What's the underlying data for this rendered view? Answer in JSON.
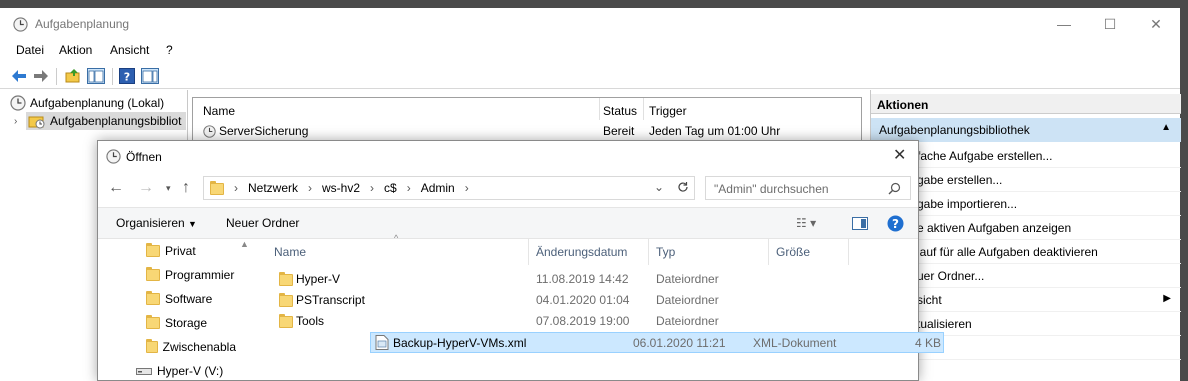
{
  "window": {
    "title": "Aufgabenplanung",
    "min": "—",
    "max": "☐",
    "close": "✕"
  },
  "menu": [
    "Datei",
    "Aktion",
    "Ansicht",
    "?"
  ],
  "tree": {
    "root": "Aufgabenplanung (Lokal)",
    "child": "Aufgabenplanungsbibliot"
  },
  "tasklist": {
    "columns": [
      "Name",
      "Status",
      "Trigger"
    ],
    "rows": [
      {
        "name": "ServerSicherung",
        "status": "Bereit",
        "trigger": "Jeden Tag um 01:00 Uhr"
      }
    ]
  },
  "actions": {
    "header": "Aktionen",
    "section": "Aufgabenplanungsbibliothek",
    "items": [
      "fache Aufgabe erstellen...",
      "gabe erstellen...",
      "gabe importieren...",
      "e aktiven Aufgaben anzeigen",
      "lauf für alle Aufgaben deaktivieren",
      "uer Ordner...",
      "sicht",
      "tualisieren",
      "fe"
    ]
  },
  "dialog": {
    "title": "Öffnen",
    "breadcrumb": [
      "Netzwerk",
      "ws-hv2",
      "c$",
      "Admin"
    ],
    "search_placeholder": "\"Admin\" durchsuchen",
    "organize": "Organisieren",
    "new_folder": "Neuer Ordner",
    "nav_items": [
      "Privat",
      "Programmier",
      "Software",
      "Storage",
      "Zwischenabla",
      "Hyper-V (V:)"
    ],
    "columns": [
      "Name",
      "Änderungsdatum",
      "Typ",
      "Größe"
    ],
    "files": [
      {
        "name": "Hyper-V",
        "date": "11.08.2019 14:42",
        "type": "Dateiordner",
        "size": ""
      },
      {
        "name": "PSTranscript",
        "date": "04.01.2020 01:04",
        "type": "Dateiordner",
        "size": ""
      },
      {
        "name": "Tools",
        "date": "07.08.2019 19:00",
        "type": "Dateiordner",
        "size": ""
      },
      {
        "name": "Backup-HyperV-VMs.xml",
        "date": "06.01.2020 11:21",
        "type": "XML-Dokument",
        "size": "4 KB"
      }
    ]
  }
}
